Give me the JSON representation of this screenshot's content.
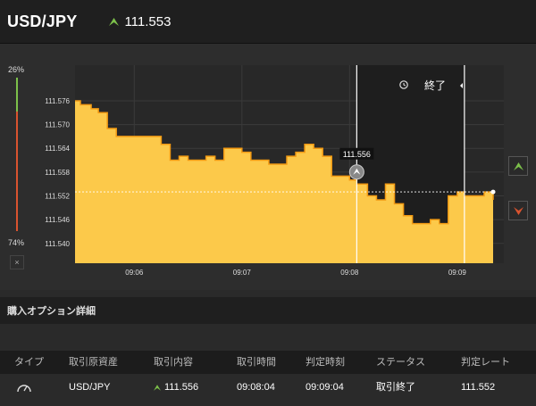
{
  "header": {
    "pair": "USD/JPY",
    "rate": "111.553",
    "direction_icon": "up-arrow-icon"
  },
  "ratio": {
    "high_pct": "26%",
    "low_pct": "74%",
    "close_label": "×"
  },
  "chart": {
    "end_label": "終了",
    "tooltip_value": "111.556",
    "current_rate": 111.553
  },
  "chart_data": {
    "type": "area",
    "x": [
      "09:05:27",
      "09:05:30",
      "09:05:33",
      "09:05:36",
      "09:05:40",
      "09:05:45",
      "09:05:50",
      "09:05:55",
      "09:06:00",
      "09:06:05",
      "09:06:10",
      "09:06:15",
      "09:06:20",
      "09:06:25",
      "09:06:30",
      "09:06:35",
      "09:06:40",
      "09:06:45",
      "09:06:50",
      "09:06:55",
      "09:07:00",
      "09:07:05",
      "09:07:10",
      "09:07:15",
      "09:07:20",
      "09:07:25",
      "09:07:30",
      "09:07:35",
      "09:07:40",
      "09:07:45",
      "09:07:50",
      "09:07:55",
      "09:08:00",
      "09:08:04",
      "09:08:10",
      "09:08:15",
      "09:08:20",
      "09:08:25",
      "09:08:30",
      "09:08:35",
      "09:08:40",
      "09:08:45",
      "09:08:50",
      "09:08:55",
      "09:09:00",
      "09:09:04",
      "09:09:10",
      "09:09:15",
      "09:09:20"
    ],
    "y": [
      111.576,
      111.575,
      111.575,
      111.574,
      111.573,
      111.569,
      111.567,
      111.567,
      111.567,
      111.567,
      111.567,
      111.565,
      111.561,
      111.562,
      111.561,
      111.561,
      111.562,
      111.561,
      111.564,
      111.564,
      111.563,
      111.561,
      111.561,
      111.56,
      111.56,
      111.562,
      111.563,
      111.565,
      111.564,
      111.562,
      111.557,
      111.557,
      111.556,
      111.555,
      111.552,
      111.551,
      111.555,
      111.55,
      111.547,
      111.545,
      111.545,
      111.546,
      111.545,
      111.552,
      111.553,
      111.552,
      111.552,
      111.553,
      111.551
    ],
    "xticks": [
      "09:06",
      "09:07",
      "09:08",
      "09:09"
    ],
    "yticks": [
      111.576,
      111.57,
      111.564,
      111.558,
      111.552,
      111.546,
      111.54
    ],
    "ylim": [
      111.535,
      111.585
    ],
    "grid": true,
    "markers": {
      "entry_time": "09:08:04",
      "expiry_time": "09:09:04",
      "entry_rate": 111.556,
      "current_rate": 111.553
    },
    "colors": {
      "fill": "#fcc94a",
      "line": "#f29a13",
      "dark_bg": "#1e1e1e"
    }
  },
  "section": {
    "title": "購入オプション詳細"
  },
  "table": {
    "headers": [
      "タイプ",
      "取引原資産",
      "取引内容",
      "取引時間",
      "判定時刻",
      "ステータス",
      "判定レート"
    ],
    "row": {
      "type_icon": "gauge-icon",
      "asset": "USD/JPY",
      "direction_icon": "up-arrow-icon",
      "content": "111.556",
      "trade_time": "09:08:04",
      "judge_time": "09:09:04",
      "status": "取引終了",
      "judge_rate": "111.552"
    }
  },
  "colors": {
    "up": "#7cc04a",
    "down": "#d9532f",
    "accent": "#fcc94a"
  }
}
